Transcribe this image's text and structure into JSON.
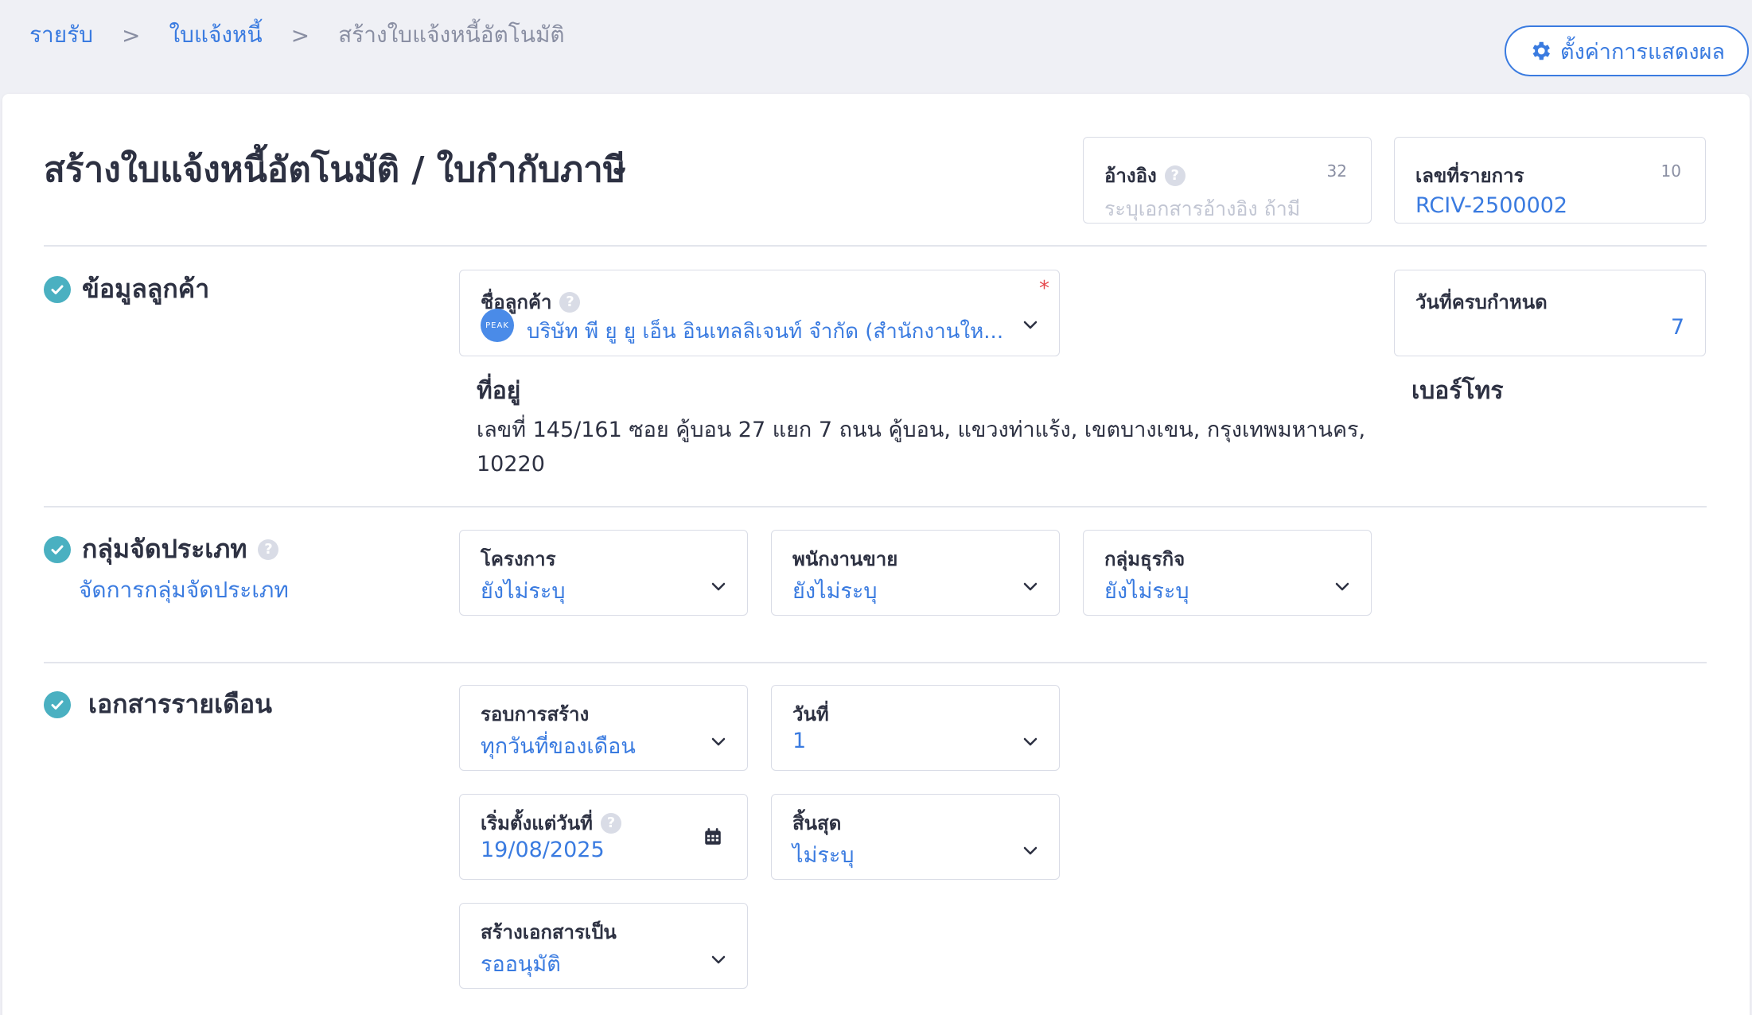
{
  "breadcrumb": {
    "items": [
      "รายรับ",
      "ใบแจ้งหนี้",
      "สร้างใบแจ้งหนี้อัตโนมัติ"
    ],
    "separator": ">"
  },
  "header": {
    "settings_label": "ตั้งค่าการแสดงผล"
  },
  "page": {
    "title": "สร้างใบแจ้งหนี้อัตโนมัติ / ใบกำกับภาษี"
  },
  "reference": {
    "label": "อ้างอิง",
    "count": "32",
    "placeholder": "ระบุเอกสารอ้างอิง ถ้ามี"
  },
  "doc_number": {
    "label": "เลขที่รายการ",
    "count": "10",
    "value": "RCIV-2500002"
  },
  "customer_section": {
    "title": "ข้อมูลลูกค้า",
    "customer_label": "ชื่อลูกค้า",
    "required_mark": "*",
    "avatar_text": "PEAK",
    "customer_value": "บริษัท พี ยู ยู เอ็น อินเทลลิเจนท์ จำกัด (สำนักงานให...",
    "address_label": "ที่อยู่",
    "address_line1": "เลขที่ 145/161 ซอย คู้บอน 27 แยก 7 ถนน คู้บอน, แขวงท่าแร้ง, เขตบางเขน, กรุงเทพมหานคร,",
    "address_line2": "10220",
    "due_label": "วันที่ครบกำหนด",
    "due_value": "7",
    "phone_label": "เบอร์โทร"
  },
  "classification_section": {
    "title": "กลุ่มจัดประเภท",
    "manage_link": "จัดการกลุ่มจัดประเภท",
    "project_label": "โครงการ",
    "project_value": "ยังไม่ระบุ",
    "salesperson_label": "พนักงานขาย",
    "salesperson_value": "ยังไม่ระบุ",
    "business_group_label": "กลุ่มธุรกิจ",
    "business_group_value": "ยังไม่ระบุ"
  },
  "monthly_section": {
    "title": "เอกสารรายเดือน",
    "cycle_label": "รอบการสร้าง",
    "cycle_value": "ทุกวันที่ของเดือน",
    "day_label": "วันที่",
    "day_value": "1",
    "start_label": "เริ่มตั้งแต่วันที่",
    "start_value": "19/08/2025",
    "end_label": "สิ้นสุด",
    "end_value": "ไม่ระบุ",
    "create_as_label": "สร้างเอกสารเป็น",
    "create_as_value": "รออนุมัติ"
  },
  "icons": {
    "settings": "gear-icon",
    "check": "check-circle-icon",
    "chevron": "chevron-down-icon",
    "calendar": "calendar-icon",
    "help": "question-icon"
  },
  "colors": {
    "accent": "#3a7be0",
    "check": "#4ab0c1",
    "required": "#e5484d",
    "background": "#eff0f5"
  }
}
